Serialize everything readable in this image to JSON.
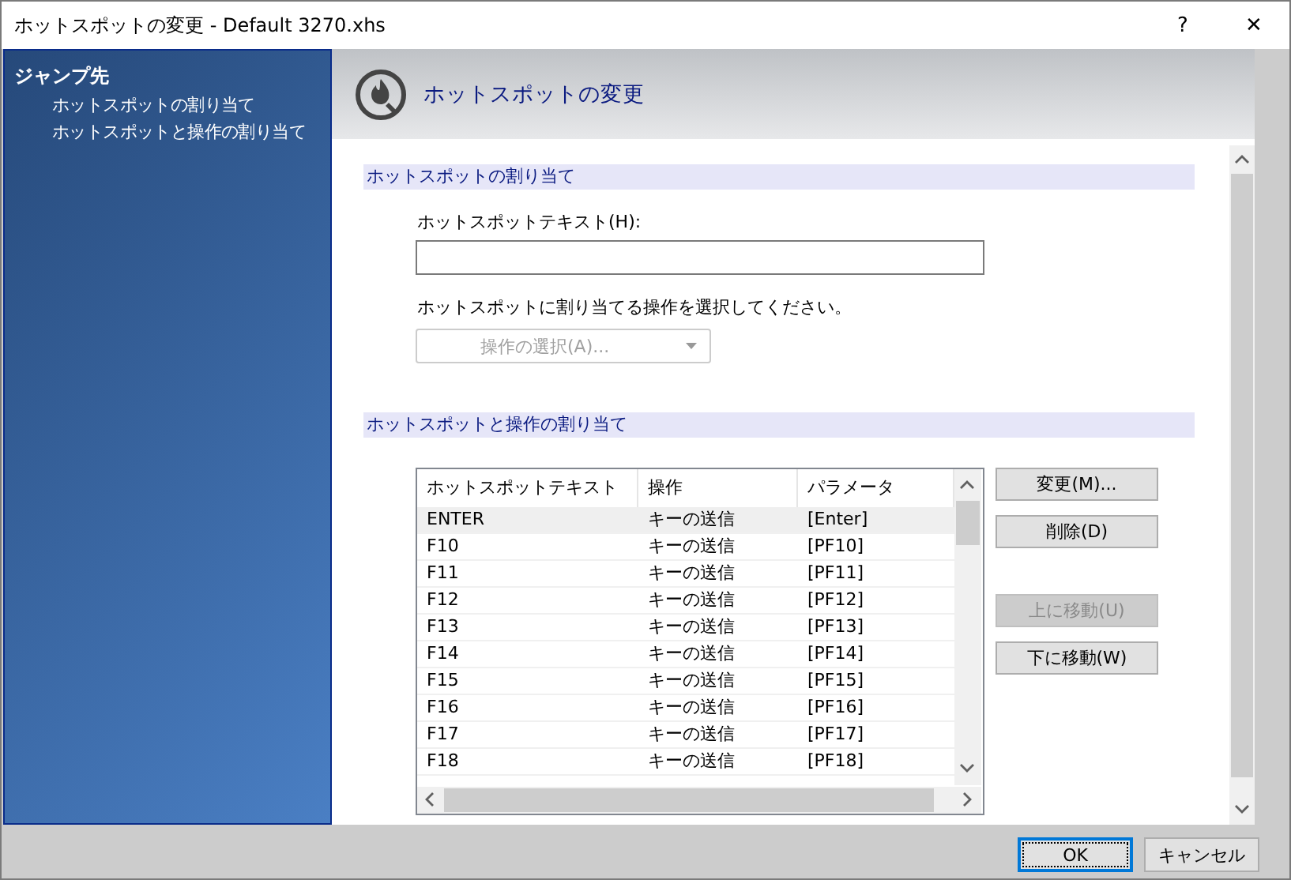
{
  "window": {
    "title": "ホットスポットの変更 - Default 3270.xhs",
    "help": "?",
    "close": "✕"
  },
  "sidebar": {
    "heading": "ジャンプ先",
    "items": [
      "ホットスポットの割り当て",
      "ホットスポットと操作の割り当て"
    ]
  },
  "header": {
    "title": "ホットスポットの変更"
  },
  "section_1": {
    "title": "ホットスポットの割り当て",
    "text_label": "ホットスポットテキスト(H):",
    "action_label": "ホットスポットに割り当てる操作を選択してください。",
    "action_select": {
      "label": "操作の選択(A)...",
      "disabled": true
    }
  },
  "section_2": {
    "title": "ホットスポットと操作の割り当て",
    "table": {
      "columns": [
        "ホットスポットテキスト",
        "操作",
        "パラメータ"
      ],
      "rows": [
        {
          "cells": [
            "ENTER",
            "キーの送信",
            "[Enter]"
          ],
          "selected": true
        },
        {
          "cells": [
            "F10",
            "キーの送信",
            "[PF10]"
          ],
          "selected": false
        },
        {
          "cells": [
            "F11",
            "キーの送信",
            "[PF11]"
          ],
          "selected": false
        },
        {
          "cells": [
            "F12",
            "キーの送信",
            "[PF12]"
          ],
          "selected": false
        },
        {
          "cells": [
            "F13",
            "キーの送信",
            "[PF13]"
          ],
          "selected": false
        },
        {
          "cells": [
            "F14",
            "キーの送信",
            "[PF14]"
          ],
          "selected": false
        },
        {
          "cells": [
            "F15",
            "キーの送信",
            "[PF15]"
          ],
          "selected": false
        },
        {
          "cells": [
            "F16",
            "キーの送信",
            "[PF16]"
          ],
          "selected": false
        },
        {
          "cells": [
            "F17",
            "キーの送信",
            "[PF17]"
          ],
          "selected": false
        },
        {
          "cells": [
            "F18",
            "キーの送信",
            "[PF18]"
          ],
          "selected": false
        }
      ]
    },
    "button_groups": [
      [
        {
          "label": "変更(M)...",
          "disabled": false
        },
        {
          "label": "削除(D)",
          "disabled": false
        }
      ],
      [
        {
          "label": "上に移動(U)",
          "disabled": true
        },
        {
          "label": "下に移動(W)",
          "disabled": false
        }
      ]
    ]
  },
  "footer": {
    "buttons": [
      {
        "label": "OK",
        "default": true
      },
      {
        "label": "キャンセル",
        "default": false
      }
    ]
  }
}
